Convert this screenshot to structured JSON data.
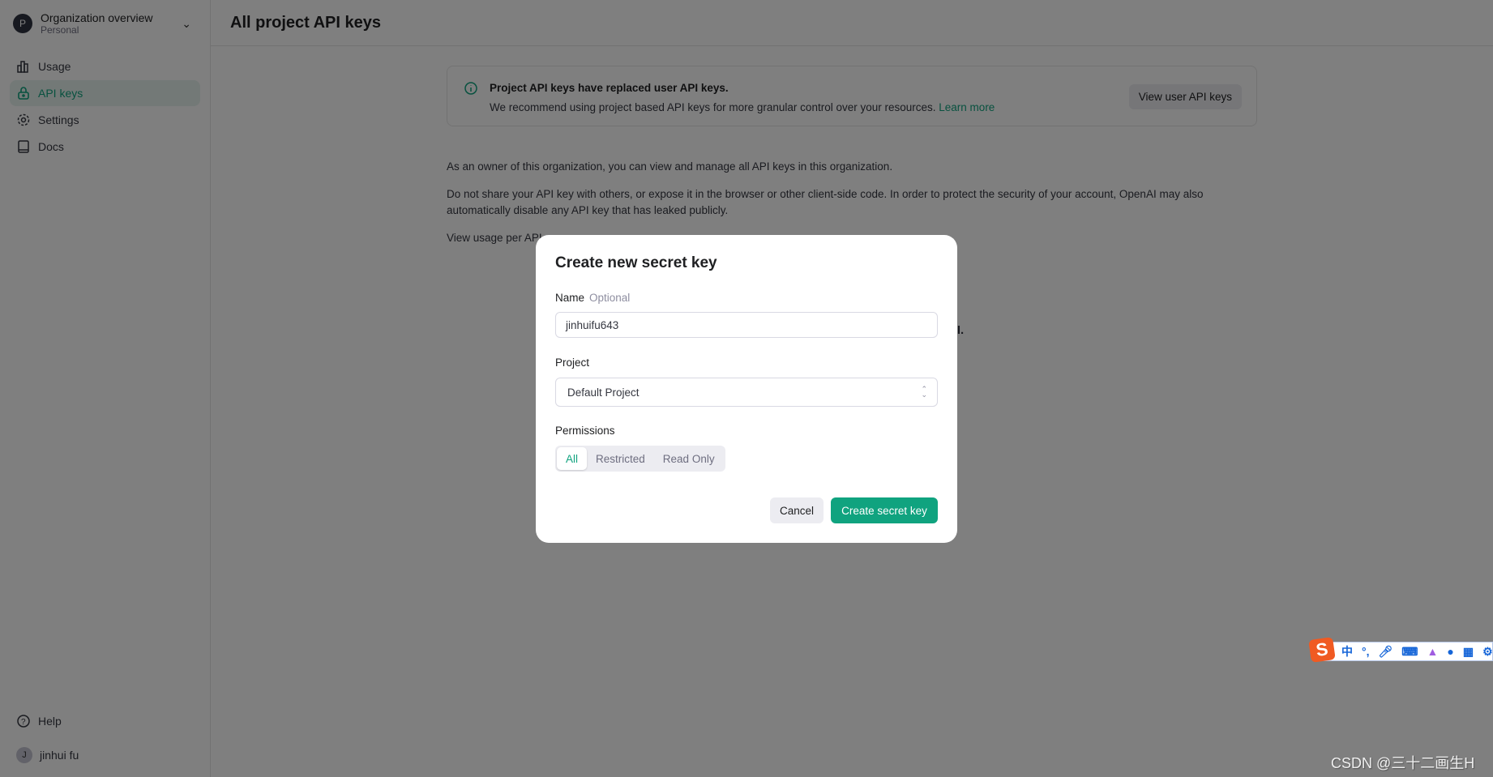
{
  "sidebar": {
    "org": {
      "initial": "P",
      "title": "Organization overview",
      "subtitle": "Personal"
    },
    "items": [
      {
        "label": "Usage",
        "icon": "bar-chart-icon"
      },
      {
        "label": "API keys",
        "icon": "lock-icon",
        "active": true
      },
      {
        "label": "Settings",
        "icon": "gear-icon"
      },
      {
        "label": "Docs",
        "icon": "book-icon"
      }
    ],
    "help": "Help",
    "user": {
      "initial": "J",
      "name": "jinhui fu"
    }
  },
  "header": {
    "title": "All project API keys"
  },
  "banner": {
    "title": "Project API keys have replaced user API keys.",
    "text": "We recommend using project based API keys for more granular control over your resources.",
    "link": "Learn more",
    "button": "View user API keys"
  },
  "body": {
    "p1": "As an owner of this organization, you can view and manage all API keys in this organization.",
    "p2": "Do not share your API key with others, or expose it in the browser or other client-side code. In order to protect the security of your account, OpenAI may also automatically disable any API key that has leaked publicly.",
    "p3": "View usage per API",
    "p4": "API."
  },
  "modal": {
    "title": "Create new secret key",
    "name_label": "Name",
    "name_hint": "Optional",
    "name_value": "jinhuifu643",
    "project_label": "Project",
    "project_value": "Default Project",
    "permissions_label": "Permissions",
    "permissions": [
      "All",
      "Restricted",
      "Read Only"
    ],
    "permissions_selected": "All",
    "cancel": "Cancel",
    "create": "Create secret key"
  },
  "colors": {
    "accent": "#10a37f"
  },
  "ime": {
    "logo": "S",
    "mode": "中",
    "punct": "°,"
  },
  "watermark": "CSDN @三十二画生H"
}
